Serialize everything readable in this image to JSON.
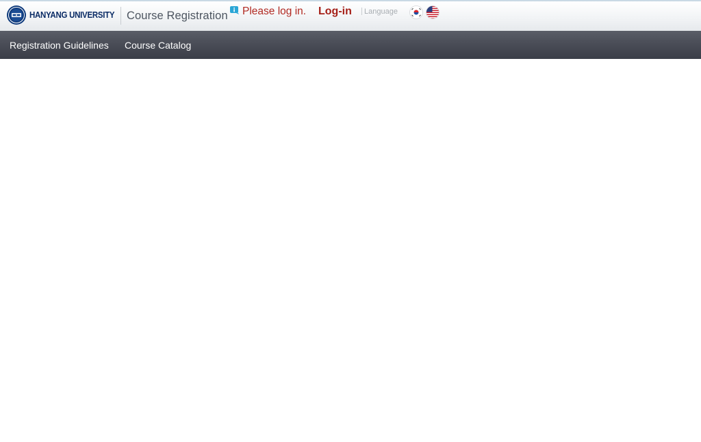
{
  "header": {
    "logo_text": "HANYANG UNIVERSITY",
    "logo_icon": "university-seal-icon",
    "site_title": "Course Registration",
    "info_icon": "info-icon",
    "login_message": "Please log in.",
    "login_link": "Log-in",
    "language_label": "Language",
    "flags": [
      {
        "name": "korean-flag-icon"
      },
      {
        "name": "us-flag-icon"
      }
    ]
  },
  "nav": {
    "items": [
      {
        "label": "Registration Guidelines"
      },
      {
        "label": "Course Catalog"
      }
    ]
  },
  "colors": {
    "brand_navy": "#0b2c66",
    "login_red": "#b12a22",
    "nav_bg": "#4a4d57",
    "nav_text": "#ffffff"
  }
}
